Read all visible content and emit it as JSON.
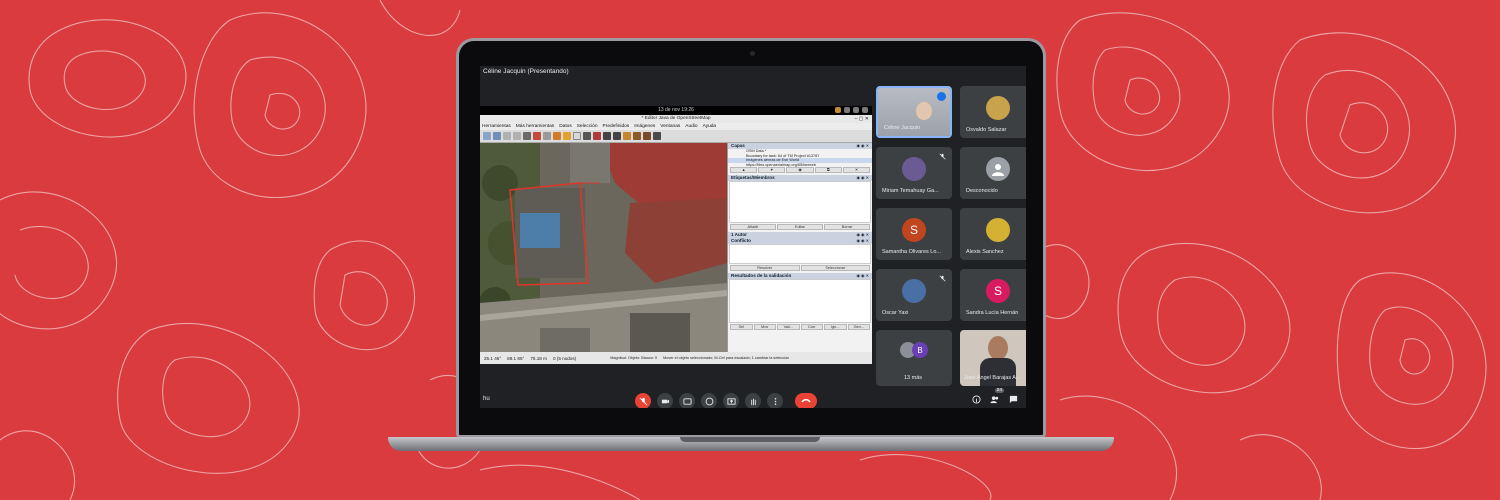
{
  "meet": {
    "presenter_label": "Céline Jacquin (Presentando)",
    "meeting_code": "hu",
    "participants_count": "24"
  },
  "desktop": {
    "clock": "13 de nov  19:26"
  },
  "josm": {
    "title": "* Editor Java de OpenStreetMap",
    "menu": [
      "Herramientas",
      "Más herramientas",
      "Datos",
      "Selección",
      "Predefinidos",
      "Imágenes",
      "Ventanas",
      "Audio",
      "Ayuda"
    ],
    "panels": {
      "layers": {
        "title": "Capas",
        "items": [
          "OSM Data *",
          "Boundary for task: 64 of TM Project #13787",
          "Imágenes aéreas de Esri World",
          "https://tiles.openaerialmap.org/65/beeeeb"
        ]
      },
      "tags": {
        "title": "Etiquetas/Miembros",
        "buttons": [
          "Añadir",
          "Editar",
          "Borrar"
        ]
      },
      "author": {
        "title": "1 Autor"
      },
      "conflicts": {
        "title": "Conflicto",
        "buttons": [
          "Resolver",
          "Seleccionar"
        ]
      },
      "validation": {
        "title": "Resultados de la validación",
        "buttons": [
          "Sel",
          "Mov",
          "Vali...",
          "Corr",
          "Ign...",
          "Gen..."
        ]
      }
    },
    "status": {
      "lat": "25.1 46°",
      "lon": "89.1 85°",
      "angle": "75.18 m",
      "dist": "0 (5 nodos)",
      "hint": "Mover el objeto seleccionado; M-Ctrl para escalado; 1 cambiar la selección",
      "help": "Magnitud: Objeto: Bianco: 0"
    }
  },
  "participants": [
    {
      "name": "Céline Jacquin",
      "avatar": "",
      "color": "#8a8f98",
      "muted": false,
      "speaking": true
    },
    {
      "name": "Osvaldo Salazar",
      "avatar": "",
      "color": "#c9a34b",
      "muted": false
    },
    {
      "name": "Miriam Temahuay Ga...",
      "avatar": "",
      "color": "#6b5b95",
      "muted": true
    },
    {
      "name": "Desconocido",
      "avatar": "",
      "color": "#9aa0a6",
      "muted": false
    },
    {
      "name": "Samantha Olivares Lo...",
      "avatar": "S",
      "color": "#c1451f",
      "muted": false
    },
    {
      "name": "Alexis Sanchez",
      "avatar": "",
      "color": "#d4b133",
      "muted": false
    },
    {
      "name": "Oscar Yaxi",
      "avatar": "",
      "color": "#4a6fa5",
      "muted": true
    },
    {
      "name": "Sandra Lucía Hernán",
      "avatar": "S",
      "color": "#d81b60",
      "muted": false
    },
    {
      "name": "13 más",
      "avatar": "B",
      "color": "#6a3fb5",
      "muted": false
    },
    {
      "name": "José Angel Barajas A...",
      "avatar": "",
      "color": "#7a6a58",
      "muted": false
    }
  ],
  "icons": {
    "mic": "mic-off-icon",
    "camera": "camera-icon",
    "captions": "captions-icon",
    "emoji": "emoji-icon",
    "present": "present-icon",
    "hand": "raise-hand-icon",
    "more": "more-vert-icon",
    "end": "end-call-icon",
    "info": "info-icon",
    "people": "people-icon",
    "chat": "chat-icon"
  }
}
